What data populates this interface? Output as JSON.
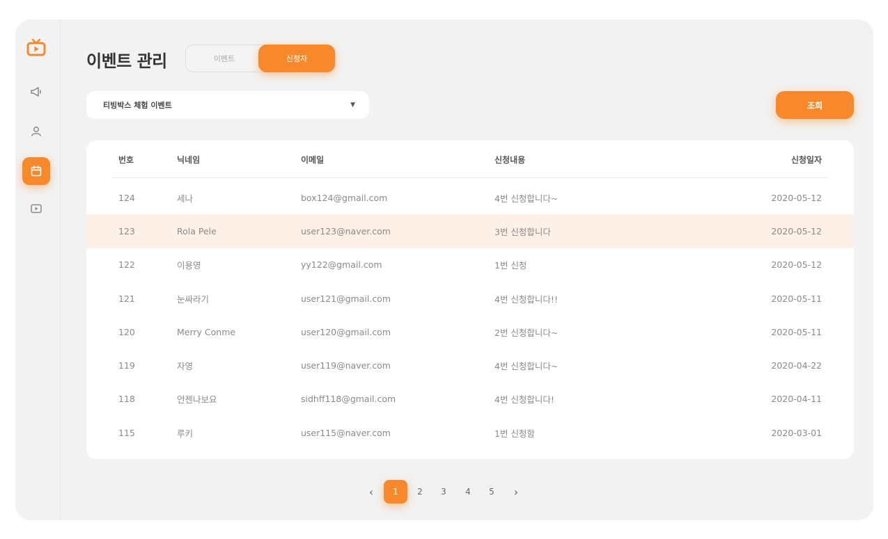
{
  "app": {
    "title": "이벤트 관리",
    "accent_color": "#f7892a"
  },
  "sidebar": {
    "items": [
      {
        "icon": "tv-logo-icon",
        "active": false
      },
      {
        "icon": "megaphone-icon",
        "active": false
      },
      {
        "icon": "user-icon",
        "active": false
      },
      {
        "icon": "calendar-icon",
        "active": true
      },
      {
        "icon": "video-play-icon",
        "active": false
      }
    ]
  },
  "toggle": {
    "left_label": "이벤트",
    "right_label": "신청자",
    "selected": "신청자"
  },
  "filter": {
    "selected": "티빙박스 체험 이벤트"
  },
  "query_button": "조회",
  "table": {
    "headers": {
      "no": "번호",
      "nickname": "닉네임",
      "email": "이메일",
      "content": "신청내용",
      "date": "신청일자"
    },
    "rows": [
      {
        "no": "124",
        "nickname": "세나",
        "email": "box124@gmail.com",
        "content": "4번 신청합니다~",
        "date": "2020-05-12"
      },
      {
        "no": "123",
        "nickname": "Rola Pele",
        "email": "user123@naver.com",
        "content": "3번 신청합니다",
        "date": "2020-05-12"
      },
      {
        "no": "122",
        "nickname": "이용영",
        "email": "yy122@gmail.com",
        "content": "1번 신청",
        "date": "2020-05-12"
      },
      {
        "no": "121",
        "nickname": "눈싸라기",
        "email": "user121@gmail.com",
        "content": "4번 신청합니다!!",
        "date": "2020-05-11"
      },
      {
        "no": "120",
        "nickname": "Merry Conme",
        "email": "user120@gmail.com",
        "content": "2번 신청합니다~",
        "date": "2020-05-11"
      },
      {
        "no": "119",
        "nickname": "자영",
        "email": "user119@naver.com",
        "content": "4번 신청합니다~",
        "date": "2020-04-22"
      },
      {
        "no": "118",
        "nickname": "언젠나보요",
        "email": "sidhff118@gmail.com",
        "content": "4번 신청합니다!",
        "date": "2020-04-11"
      },
      {
        "no": "115",
        "nickname": "루키",
        "email": "user115@naver.com",
        "content": "1번 신청함",
        "date": "2020-03-01"
      }
    ]
  },
  "pagination": {
    "prev": "‹",
    "next": "›",
    "pages": [
      "1",
      "2",
      "3",
      "4",
      "5"
    ],
    "current": "1"
  }
}
